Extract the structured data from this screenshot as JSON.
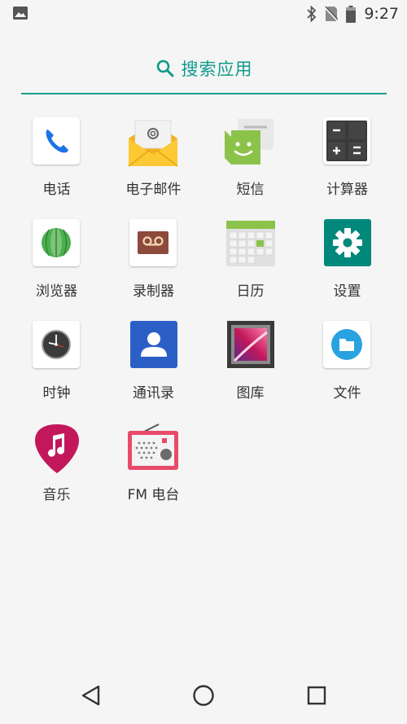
{
  "status_bar": {
    "time": "9:27",
    "icons": [
      "image-icon",
      "bluetooth-icon",
      "no-sim-icon",
      "battery-icon"
    ]
  },
  "search": {
    "label": "搜索应用",
    "icon": "search-icon",
    "accent_color": "#0f9a8a"
  },
  "apps": [
    {
      "id": "phone",
      "label": "电话",
      "icon": "phone-icon"
    },
    {
      "id": "email",
      "label": "电子邮件",
      "icon": "email-icon"
    },
    {
      "id": "messages",
      "label": "短信",
      "icon": "messages-icon"
    },
    {
      "id": "calculator",
      "label": "计算器",
      "icon": "calculator-icon"
    },
    {
      "id": "browser",
      "label": "浏览器",
      "icon": "browser-icon"
    },
    {
      "id": "recorder",
      "label": "录制器",
      "icon": "recorder-icon"
    },
    {
      "id": "calendar",
      "label": "日历",
      "icon": "calendar-icon"
    },
    {
      "id": "settings",
      "label": "设置",
      "icon": "settings-icon"
    },
    {
      "id": "clock",
      "label": "时钟",
      "icon": "clock-icon"
    },
    {
      "id": "contacts",
      "label": "通讯录",
      "icon": "contacts-icon"
    },
    {
      "id": "gallery",
      "label": "图库",
      "icon": "gallery-icon"
    },
    {
      "id": "files",
      "label": "文件",
      "icon": "files-icon"
    },
    {
      "id": "music",
      "label": "音乐",
      "icon": "music-icon"
    },
    {
      "id": "fm_radio",
      "label": "FM 电台",
      "icon": "fm-radio-icon"
    }
  ],
  "nav_bar": {
    "buttons": [
      "back-icon",
      "home-icon",
      "recents-icon"
    ]
  }
}
